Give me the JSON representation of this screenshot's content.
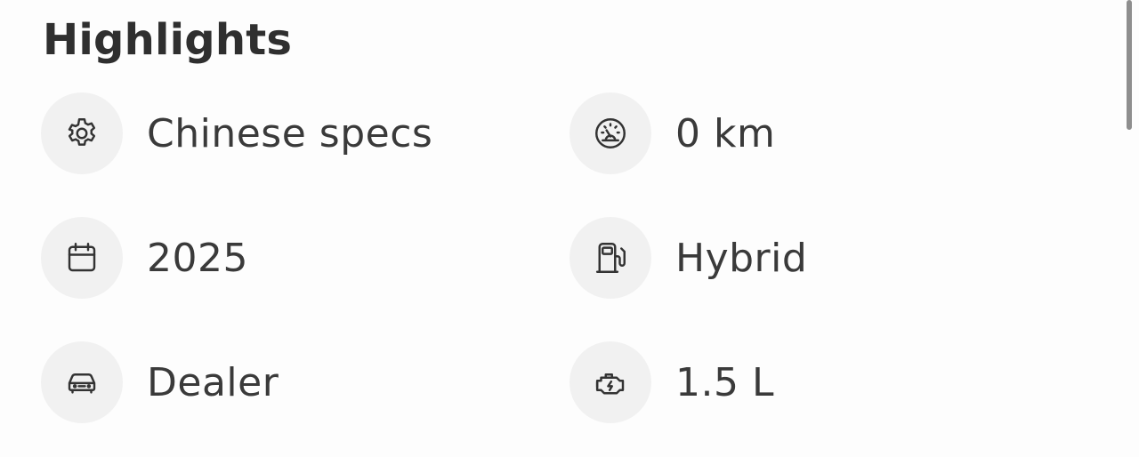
{
  "section": {
    "title": "Highlights"
  },
  "highlights": [
    {
      "icon": "gear-icon",
      "label": "Chinese specs"
    },
    {
      "icon": "speedometer-icon",
      "label": "0 km"
    },
    {
      "icon": "calendar-icon",
      "label": "2025"
    },
    {
      "icon": "fuel-pump-icon",
      "label": "Hybrid"
    },
    {
      "icon": "car-icon",
      "label": "Dealer"
    },
    {
      "icon": "engine-icon",
      "label": "1.5 L"
    }
  ]
}
